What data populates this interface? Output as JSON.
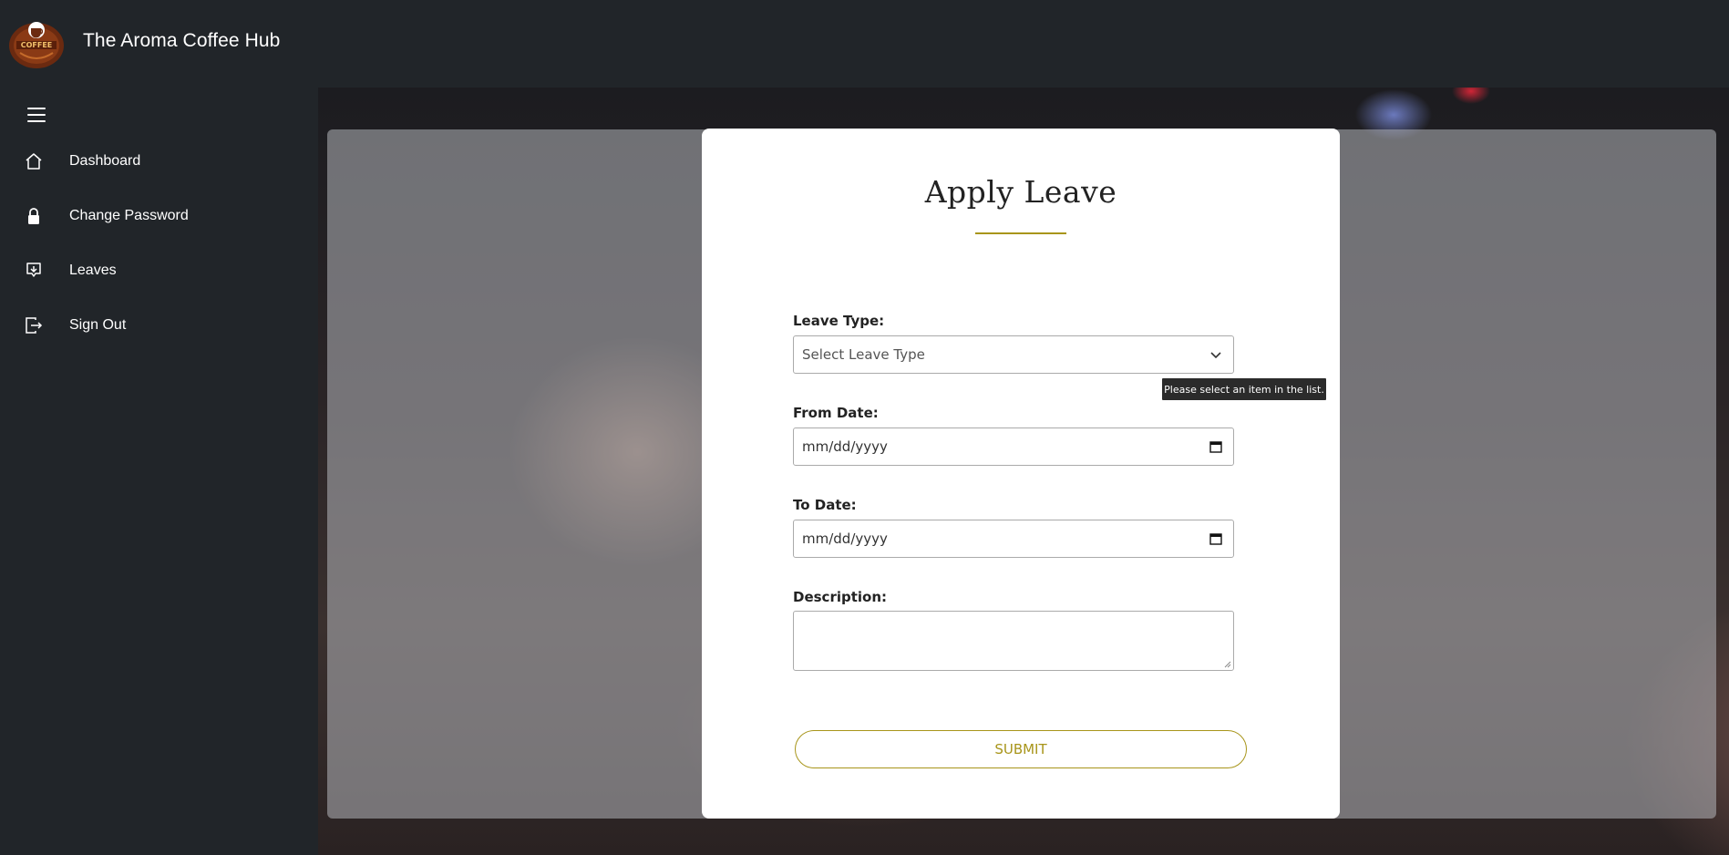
{
  "app": {
    "title": "The Aroma Coffee Hub",
    "logo_text": "COFFEE"
  },
  "sidebar": {
    "items": [
      {
        "label": "Dashboard",
        "icon": "home-icon"
      },
      {
        "label": "Change Password",
        "icon": "lock-icon"
      },
      {
        "label": "Leaves",
        "icon": "download-box-icon"
      },
      {
        "label": "Sign Out",
        "icon": "sign-out-icon"
      }
    ]
  },
  "form": {
    "title": "Apply Leave",
    "leave_type": {
      "label": "Leave Type:",
      "selected": "Select Leave Type"
    },
    "tooltip": "Please select an item in the list.",
    "from_date": {
      "label": "From Date:",
      "placeholder": "mm/dd/yyyy"
    },
    "to_date": {
      "label": "To Date:",
      "placeholder": "mm/dd/yyyy"
    },
    "description": {
      "label": "Description:",
      "value": ""
    },
    "submit_label": "SUBMIT"
  },
  "colors": {
    "background": "#212529",
    "accent": "#a8951a",
    "card": "#ffffff"
  }
}
